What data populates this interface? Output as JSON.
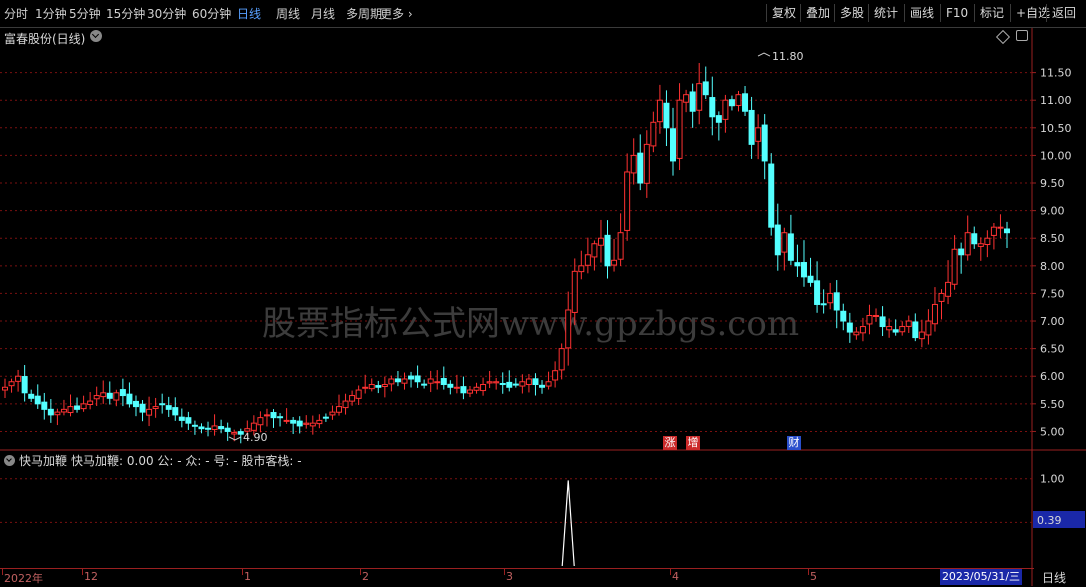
{
  "toolbar": {
    "tabs": [
      "分时",
      "1分钟",
      "5分钟",
      "15分钟",
      "30分钟",
      "60分钟",
      "日线",
      "周线",
      "月线",
      "多周期",
      "更多"
    ],
    "active_tab": "日线",
    "right_buttons": [
      "复权",
      "叠加",
      "多股",
      "统计",
      "画线",
      "F10",
      "标记",
      "+自选",
      "返回"
    ]
  },
  "main_chart": {
    "title": "富春股份(日线)",
    "watermark": "股票指标公式网www.gpzbgs.com",
    "high_label": "11.80",
    "low_label": "4.90",
    "events": [
      "涨",
      "增",
      "财"
    ]
  },
  "indicator": {
    "name": "快马加鞭",
    "text": "快马加鞭: 0.00  公: -  众: -  号: -  股市客栈: -",
    "current_value": "0.39"
  },
  "footer": {
    "dates": [
      "2022年",
      "12",
      "1",
      "2",
      "3",
      "4",
      "5"
    ],
    "current_date": "2023/05/31/三",
    "period": "日线"
  },
  "chart_data": {
    "type": "candlestick",
    "price_axis": {
      "ticks": [
        "11.50",
        "11.00",
        "10.50",
        "10.00",
        "9.50",
        "9.00",
        "8.50",
        "8.00",
        "7.50",
        "7.00",
        "6.50",
        "6.00",
        "5.50",
        "5.00"
      ],
      "ylim": [
        4.7,
        12.0
      ]
    },
    "indicator_axis": {
      "ticks": [
        "1.00",
        "0.50"
      ],
      "ylim": [
        0,
        1.1
      ]
    },
    "colors": {
      "up": "#ff3232",
      "down": "#54ffff",
      "grid": "#7a1010",
      "axis": "#9a2020"
    },
    "closes": [
      5.8,
      5.9,
      6.0,
      5.7,
      5.6,
      5.5,
      5.4,
      5.3,
      5.35,
      5.4,
      5.45,
      5.4,
      5.5,
      5.55,
      5.65,
      5.7,
      5.6,
      5.7,
      5.65,
      5.5,
      5.45,
      5.35,
      5.4,
      5.45,
      5.5,
      5.4,
      5.3,
      5.2,
      5.15,
      5.1,
      5.05,
      5.05,
      5.1,
      5.05,
      5.0,
      4.98,
      4.95,
      5.05,
      5.15,
      5.25,
      5.3,
      5.25,
      5.25,
      5.2,
      5.15,
      5.1,
      5.15,
      5.15,
      5.2,
      5.25,
      5.35,
      5.45,
      5.55,
      5.65,
      5.75,
      5.8,
      5.85,
      5.8,
      5.85,
      5.95,
      5.9,
      5.95,
      5.95,
      5.9,
      5.85,
      5.95,
      5.9,
      5.85,
      5.8,
      5.8,
      5.7,
      5.75,
      5.8,
      5.85,
      5.9,
      5.9,
      5.85,
      5.8,
      5.85,
      5.9,
      5.95,
      5.85,
      5.8,
      5.9,
      6.1,
      6.5,
      7.2,
      7.9,
      8.0,
      8.2,
      8.4,
      8.5,
      8.0,
      8.1,
      8.6,
      9.7,
      10.0,
      9.5,
      10.2,
      10.6,
      11.0,
      10.5,
      9.9,
      11.0,
      11.1,
      10.8,
      11.3,
      11.1,
      10.7,
      10.6,
      11.0,
      10.9,
      11.1,
      10.8,
      10.2,
      10.5,
      9.9,
      8.7,
      8.2,
      8.6,
      8.1,
      8.0,
      7.8,
      7.7,
      7.3,
      7.3,
      7.5,
      7.2,
      7.0,
      6.8,
      6.8,
      6.9,
      7.1,
      7.1,
      6.9,
      6.9,
      6.8,
      6.9,
      7.0,
      6.7,
      6.8,
      7.0,
      7.3,
      7.5,
      7.7,
      8.3,
      8.2,
      8.6,
      8.4,
      8.4,
      8.5,
      8.7,
      8.7,
      8.6
    ]
  }
}
